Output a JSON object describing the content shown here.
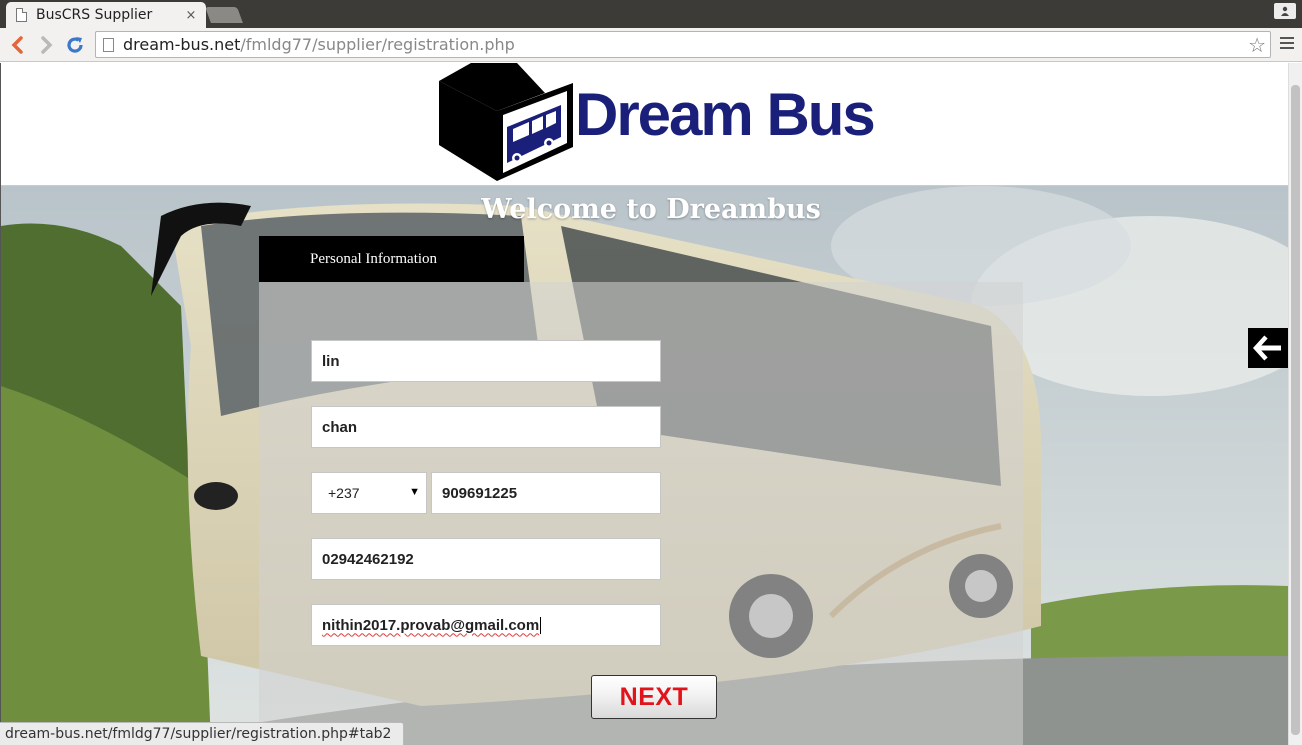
{
  "browser": {
    "tab_title": "BusCRS Supplier",
    "tab_close": "×",
    "url_host": "dream-bus.net",
    "url_path": "/fmldg77/supplier/registration.php",
    "status_url": "dream-bus.net/fmldg77/supplier/registration.php#tab2"
  },
  "header": {
    "logo_text_part1": "Dream",
    "logo_text_part2": "Bus"
  },
  "hero": {
    "welcome": "Welcome to Dreambus"
  },
  "form": {
    "tab_label": "Personal Information",
    "first_name": "lin",
    "last_name": "chan",
    "country_code": "+237",
    "mobile": "909691225",
    "phone": "02942462192",
    "email": "nithin2017.provab@gmail.com",
    "next_label": "NEXT"
  },
  "colors": {
    "brand_blue": "#1a1f7a",
    "next_red": "#e2141b",
    "tab_black": "#000000"
  },
  "icons": {
    "back": "arrow-left-icon",
    "forward": "arrow-right-icon",
    "reload": "reload-icon",
    "bookmark": "star-icon",
    "menu": "hamburger-menu-icon",
    "side": "arrow-left-white-icon"
  }
}
